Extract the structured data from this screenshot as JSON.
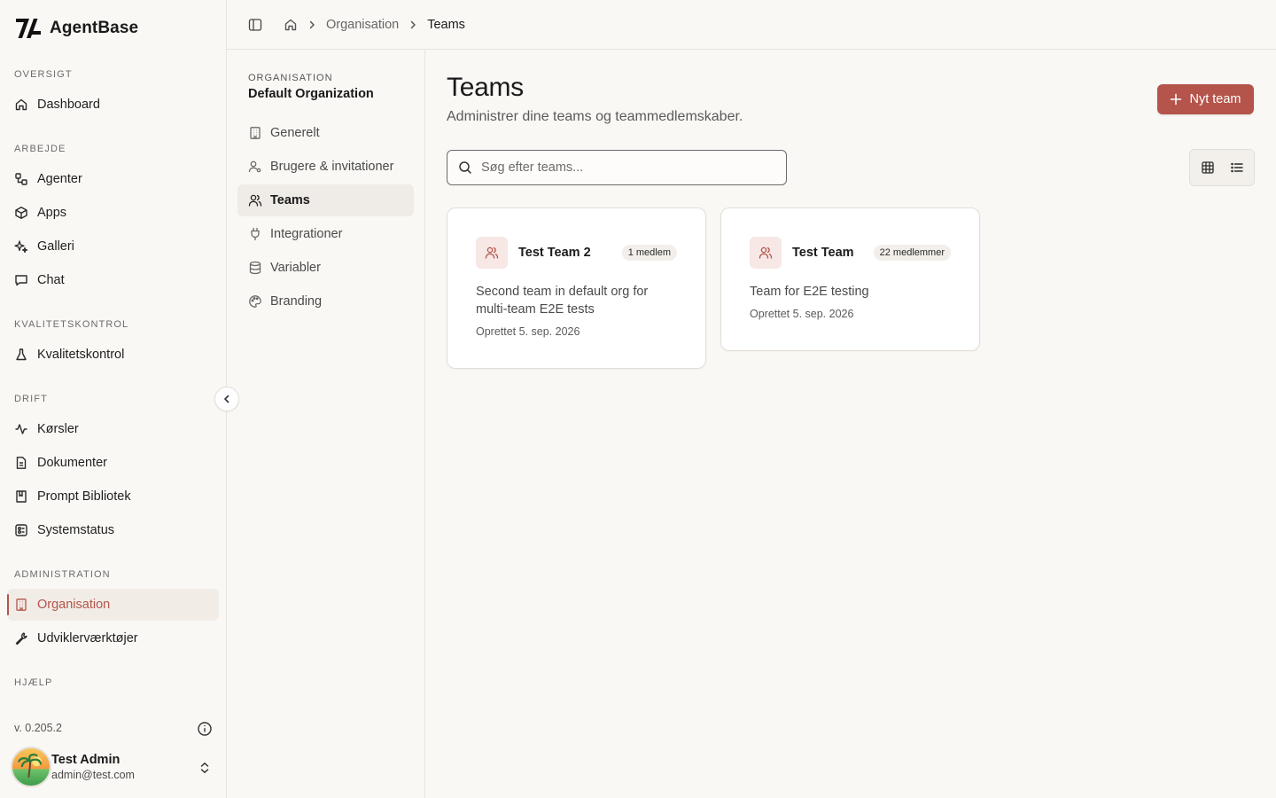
{
  "brand": {
    "name": "AgentBase"
  },
  "sidebar": {
    "sections": {
      "overview": "OVERSIGT",
      "work": "ARBEJDE",
      "quality": "KVALITETSKONTROL",
      "ops": "DRIFT",
      "admin": "ADMINISTRATION",
      "help": "HJÆLP"
    },
    "items": {
      "dashboard": "Dashboard",
      "agents": "Agenter",
      "apps": "Apps",
      "gallery": "Galleri",
      "chat": "Chat",
      "quality": "Kvalitetskontrol",
      "runs": "Kørsler",
      "documents": "Dokumenter",
      "prompt_library": "Prompt Bibliotek",
      "system_status": "Systemstatus",
      "organisation": "Organisation",
      "dev_tools": "Udviklerværktøjer"
    },
    "active_item": "organisation",
    "version": "v. 0.205.2",
    "user": {
      "name": "Test Admin",
      "email": "admin@test.com"
    }
  },
  "breadcrumb": {
    "organisation": "Organisation",
    "current": "Teams"
  },
  "subnav": {
    "label": "ORGANISATION",
    "org_name": "Default Organization",
    "items": {
      "general": "Generelt",
      "users": "Brugere & invitationer",
      "teams": "Teams",
      "integrations": "Integrationer",
      "variables": "Variabler",
      "branding": "Branding"
    },
    "active_item": "teams"
  },
  "main": {
    "title": "Teams",
    "subtitle": "Administrer dine teams og teammedlemskaber.",
    "new_button": "Nyt team",
    "search_placeholder": "Søg efter teams...",
    "view_mode": "grid",
    "teams": [
      {
        "name": "Test Team 2",
        "members": "1 medlem",
        "description": "Second team in default org for multi-team E2E tests",
        "created": "Oprettet 5. sep. 2026"
      },
      {
        "name": "Test Team",
        "members": "22 medlemmer",
        "description": "Team for E2E testing",
        "created": "Oprettet 5. sep. 2026"
      }
    ]
  },
  "colors": {
    "accent": "#b4544a",
    "background": "#faf8f5"
  }
}
